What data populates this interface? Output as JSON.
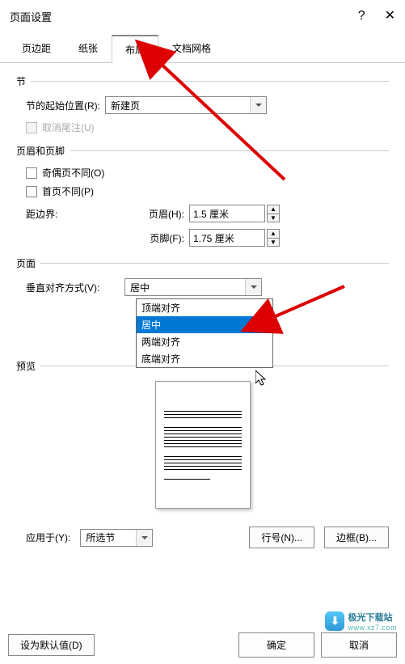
{
  "titlebar": {
    "title": "页面设置"
  },
  "tabs": {
    "margin": "页边距",
    "paper": "纸张",
    "layout": "布局",
    "grid": "文档网格"
  },
  "section": {
    "group": "节",
    "start_label": "节的起始位置(R):",
    "start_value": "新建页",
    "suppress_endnotes": "取消尾注(U)"
  },
  "headers": {
    "group": "页眉和页脚",
    "diff_odd_even": "奇偶页不同(O)",
    "diff_first": "首页不同(P)",
    "from_edge": "距边界:",
    "header_label": "页眉(H):",
    "header_val": "1.5 厘米",
    "footer_label": "页脚(F):",
    "footer_val": "1.75 厘米"
  },
  "page": {
    "group": "页面",
    "valign_label": "垂直对齐方式(V):",
    "valign_value": "居中",
    "options": {
      "top": "顶端对齐",
      "center": "居中",
      "justify": "两端对齐",
      "bottom": "底端对齐"
    }
  },
  "preview": {
    "group": "预览"
  },
  "apply": {
    "label": "应用于(Y):",
    "value": "所选节",
    "line_numbers": "行号(N)...",
    "borders": "边框(B)..."
  },
  "buttons": {
    "default": "设为默认值(D)",
    "ok": "确定",
    "cancel": "取消"
  },
  "watermark": {
    "cn": "极光下载站",
    "en": "www.xz7.com"
  }
}
